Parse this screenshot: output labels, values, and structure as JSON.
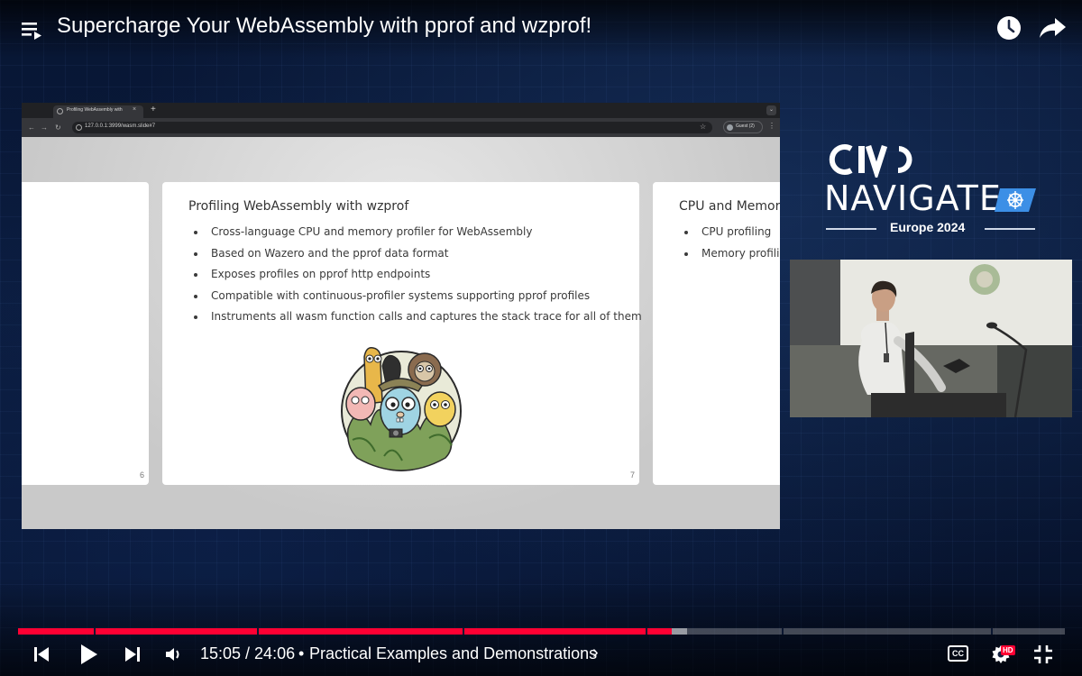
{
  "video": {
    "title": "Supercharge Your WebAssembly with pprof and wzprof!"
  },
  "browser": {
    "tab_title": "Profiling WebAssembly with",
    "url": "127.0.0.1:3999/wasm.slide#7",
    "profile_chip": "Guest (2)"
  },
  "slides": {
    "previous": {
      "number": "6"
    },
    "current": {
      "number": "7",
      "title": "Profiling WebAssembly with wzprof",
      "bullets": [
        "Cross-language CPU and memory profiler for WebAssembly",
        "Based on Wazero and the pprof data format",
        "Exposes profiles on pprof http endpoints",
        "Compatible with continuous-profiler systems supporting pprof profiles",
        "Instruments all wasm function calls and captures the stack trace for all of them"
      ]
    },
    "next": {
      "title": "CPU and Memory",
      "bullets": [
        "CPU profiling",
        "Memory profiling"
      ]
    }
  },
  "event_logo": {
    "brand": "CIVO",
    "name": "NAVIGATE",
    "edition": "Europe 2024"
  },
  "player": {
    "current_time": "15:05",
    "duration": "24:06",
    "time_display": "15:05 / 24:06",
    "chapter": "Practical Examples and Demonstrations",
    "separator": "•",
    "played_fraction": 0.6245,
    "buffered_fraction": 0.639,
    "cc_label": "CC",
    "quality_badge": "HD",
    "colors": {
      "played": "#ff0033",
      "accent": "#ff0033"
    }
  },
  "icons": {
    "top": [
      "playlist-icon",
      "watch-later-icon",
      "share-icon"
    ],
    "controls": [
      "previous-icon",
      "play-icon",
      "next-icon",
      "volume-icon",
      "captions-icon",
      "settings-icon",
      "exit-fullscreen-icon"
    ]
  }
}
